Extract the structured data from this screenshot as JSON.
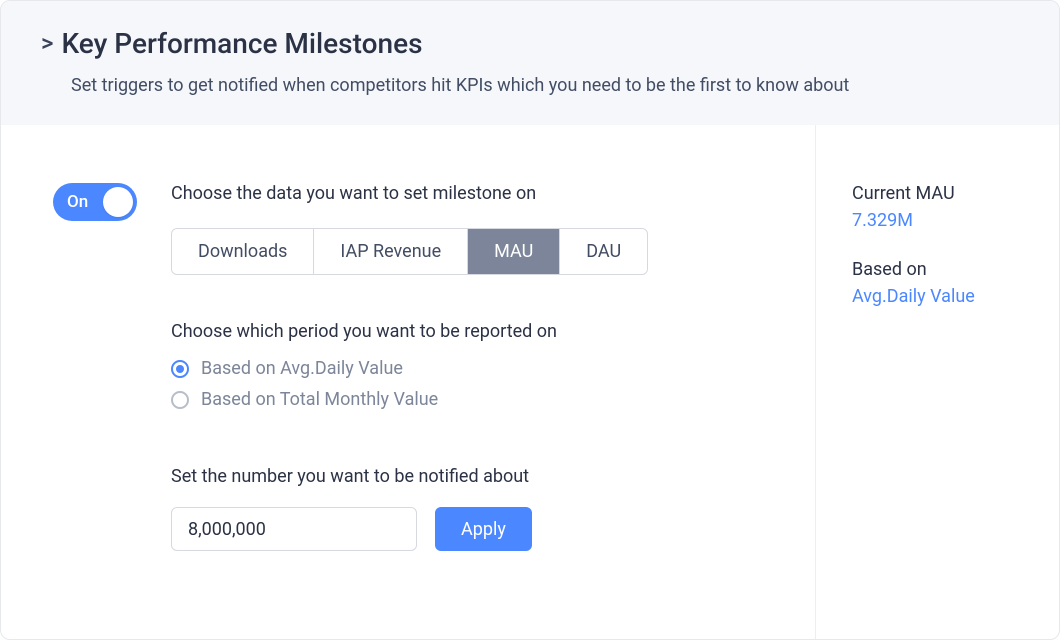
{
  "header": {
    "chevron": ">",
    "title": "Key Performance Milestones",
    "subtitle": "Set triggers to get notified when competitors hit KPIs which you need to be the first to know about"
  },
  "toggle": {
    "label": "On",
    "state": true
  },
  "dataSection": {
    "label": "Choose the data you want to set milestone on",
    "options": [
      "Downloads",
      "IAP Revenue",
      "MAU",
      "DAU"
    ],
    "selected": "MAU"
  },
  "periodSection": {
    "label": "Choose which period you want to be reported on",
    "options": [
      {
        "label": "Based on Avg.Daily Value",
        "checked": true
      },
      {
        "label": "Based on Total Monthly Value",
        "checked": false
      }
    ]
  },
  "thresholdSection": {
    "label": "Set the number you want to be notified about",
    "value": "8,000,000",
    "apply": "Apply"
  },
  "side": {
    "currentLabel": "Current MAU",
    "currentValue": "7.329M",
    "basedOnLabel": "Based on",
    "basedOnLink": "Avg.Daily Value"
  }
}
